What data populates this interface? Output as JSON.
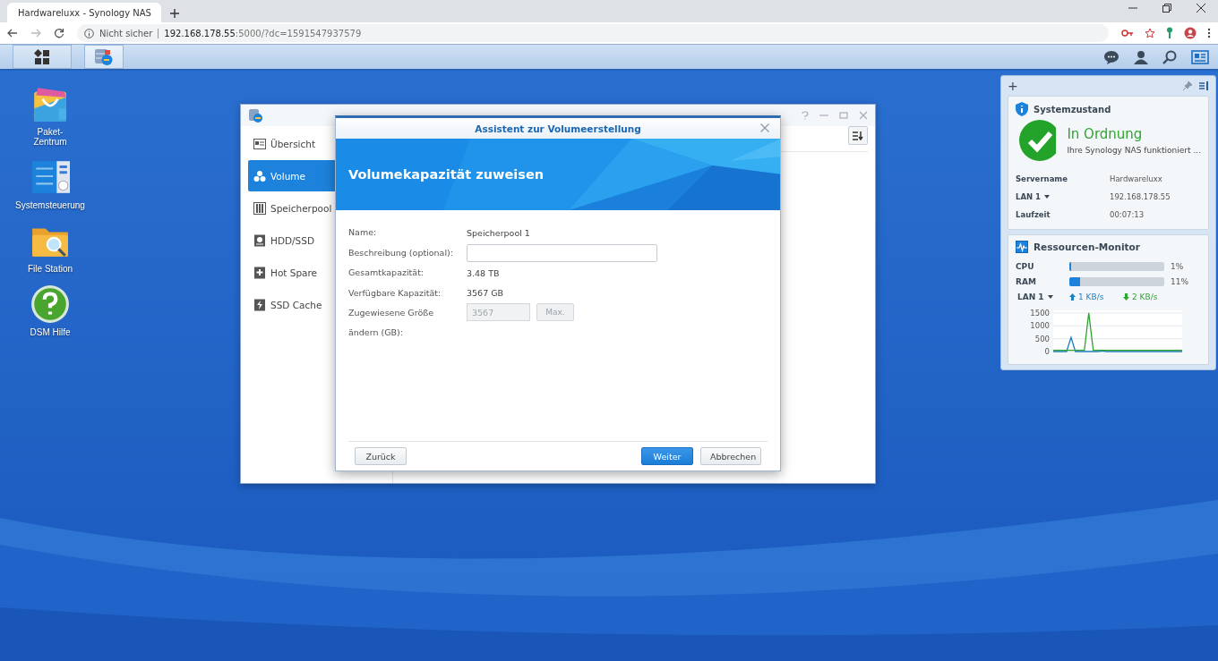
{
  "browser": {
    "tab_title": "Hardwareluxx - Synology NAS",
    "security": "Nicht sicher",
    "url_host": "192.168.178.55",
    "url_rest": ":5000/?dc=1591547937579"
  },
  "desktop_icons": [
    {
      "kind": "package",
      "label": "Paket-\nZentrum"
    },
    {
      "kind": "control",
      "label": "Systemsteuerung"
    },
    {
      "kind": "folder",
      "label": "File Station"
    },
    {
      "kind": "help",
      "label": "DSM Hilfe"
    }
  ],
  "window": {
    "nav": [
      {
        "kind": "overview",
        "label": "Übersicht",
        "selected": false
      },
      {
        "kind": "volume",
        "label": "Volume",
        "selected": true
      },
      {
        "kind": "pool",
        "label": "Speicherpool",
        "selected": false
      },
      {
        "kind": "disk",
        "label": "HDD/SSD",
        "selected": false
      },
      {
        "kind": "spare",
        "label": "Hot Spare",
        "selected": false
      },
      {
        "kind": "cache",
        "label": "SSD Cache",
        "selected": false
      }
    ]
  },
  "dialog": {
    "title": "Assistent zur Volumeerstellung",
    "heading": "Volumekapazität zuweisen",
    "fields": [
      {
        "kind": "text",
        "label": "Name:",
        "value": "Speicherpool 1"
      },
      {
        "kind": "input",
        "label": "Beschreibung (optional):"
      },
      {
        "kind": "text",
        "label": "Gesamtkapazität:",
        "value": "3.48 TB"
      },
      {
        "kind": "text",
        "label": "Verfügbare Kapazität:",
        "value": "3567 GB"
      },
      {
        "kind": "size",
        "label": "Zugewiesene Größe ändern (GB):",
        "value": "3567",
        "button": "Max.",
        "disabled": true
      }
    ],
    "back": "Zurück",
    "next": "Weiter",
    "cancel": "Abbrechen"
  },
  "widgets": {
    "add": "+",
    "system": {
      "title": "Systemzustand",
      "status": "In Ordnung",
      "message": "Ihre Synology NAS funktioniert ...",
      "rows": [
        {
          "label": "Servername",
          "value": "Hardwareluxx",
          "dropdown": false
        },
        {
          "label": "LAN 1",
          "value": "192.168.178.55",
          "dropdown": true
        },
        {
          "label": "Laufzeit",
          "value": "00:07:13",
          "dropdown": false
        }
      ]
    },
    "resources": {
      "title": "Ressourcen-Monitor",
      "meters": [
        {
          "label": "CPU",
          "level": 0.01,
          "reading": "1%"
        },
        {
          "label": "RAM",
          "level": 0.11,
          "reading": "11%"
        }
      ],
      "lan": "LAN 1",
      "upload": "1 KB/s",
      "download": "2 KB/s",
      "chart_data": {
        "type": "line",
        "ylim": [
          0,
          1600
        ],
        "yticks": [
          0,
          500,
          1000,
          1500
        ],
        "grid": true,
        "series": [
          {
            "color": "#1d7fc4",
            "values": [
              0,
              0,
              0,
              0,
              550,
              0,
              0,
              0,
              0,
              0,
              0,
              20,
              0,
              0,
              0,
              0,
              0,
              0,
              0,
              0,
              0,
              0,
              0,
              0,
              0,
              0,
              0,
              0,
              0,
              0
            ]
          },
          {
            "color": "#2ea52e",
            "values": [
              50,
              50,
              50,
              50,
              50,
              50,
              50,
              50,
              1500,
              50,
              50,
              50,
              50,
              50,
              50,
              50,
              50,
              50,
              50,
              50,
              50,
              50,
              50,
              50,
              50,
              50,
              50,
              50,
              50,
              50
            ]
          }
        ]
      }
    }
  }
}
